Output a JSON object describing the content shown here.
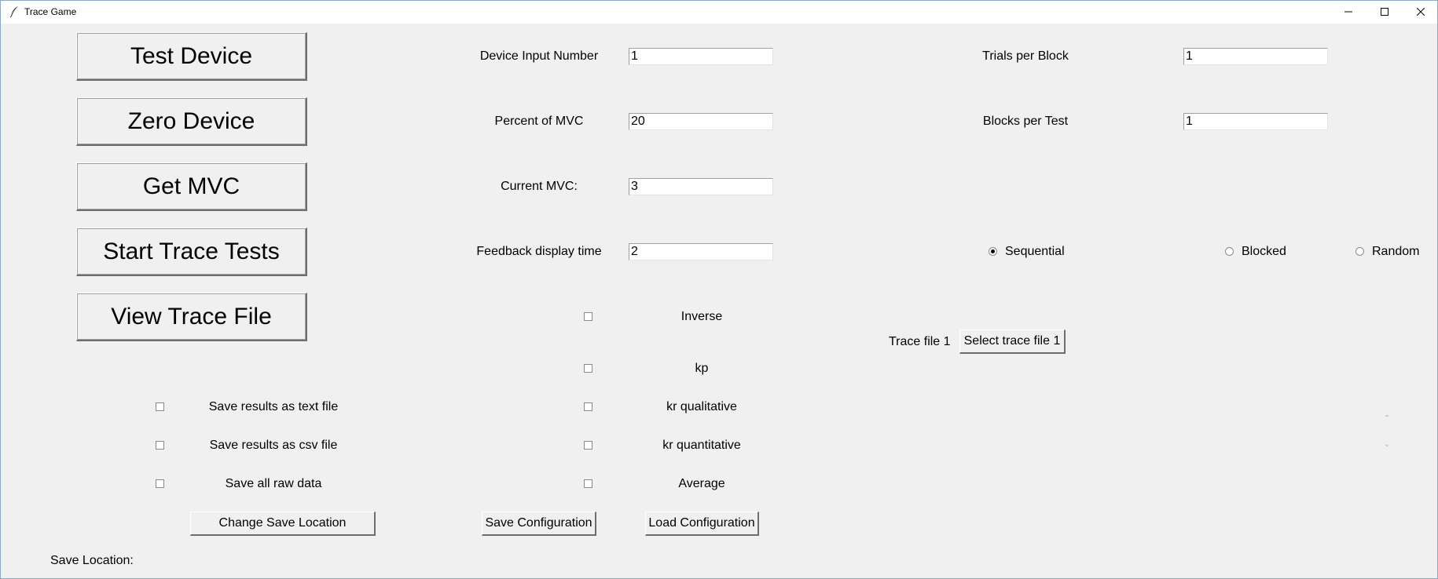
{
  "window": {
    "title": "Trace Game",
    "controls": [
      "minimize",
      "maximize",
      "close"
    ]
  },
  "buttons": {
    "test_device": "Test Device",
    "zero_device": "Zero Device",
    "get_mvc": "Get MVC",
    "start_trace_tests": "Start Trace Tests",
    "view_trace_file": "View Trace File",
    "change_save_location": "Change Save Location",
    "save_configuration": "Save Configuration",
    "load_configuration": "Load Configuration",
    "select_trace_file_1": "Select trace file 1"
  },
  "fields": {
    "device_input_number": {
      "label": "Device Input Number",
      "value": "1"
    },
    "percent_of_mvc": {
      "label": "Percent of MVC",
      "value": "20"
    },
    "current_mvc": {
      "label": "Current MVC:",
      "value": "3"
    },
    "feedback_display_time": {
      "label": "Feedback display time",
      "value": "2"
    },
    "trials_per_block": {
      "label": "Trials per Block",
      "value": "1"
    },
    "blocks_per_test": {
      "label": "Blocks per Test",
      "value": "1"
    }
  },
  "order": {
    "options": [
      {
        "label": "Sequential",
        "selected": true
      },
      {
        "label": "Blocked",
        "selected": false
      },
      {
        "label": "Random",
        "selected": false
      }
    ]
  },
  "feedback_options": [
    {
      "label": "Inverse",
      "checked": false
    },
    {
      "label": "kp",
      "checked": false
    },
    {
      "label": "kr qualitative",
      "checked": false
    },
    {
      "label": "kr quantitative",
      "checked": false
    },
    {
      "label": "Average",
      "checked": false
    }
  ],
  "save_options": [
    {
      "label": "Save results as text file",
      "checked": false
    },
    {
      "label": "Save results as csv file",
      "checked": false
    },
    {
      "label": "Save all raw data",
      "checked": false
    }
  ],
  "trace_file": {
    "label": "Trace file 1"
  },
  "save_location": {
    "label": "Save Location:",
    "value": ""
  },
  "icons": {
    "app": "feather-icon",
    "minimize": "minimize-icon",
    "maximize": "maximize-icon",
    "close": "close-icon",
    "scroll_up": "chevron-up-icon",
    "scroll_down": "chevron-down-icon"
  }
}
